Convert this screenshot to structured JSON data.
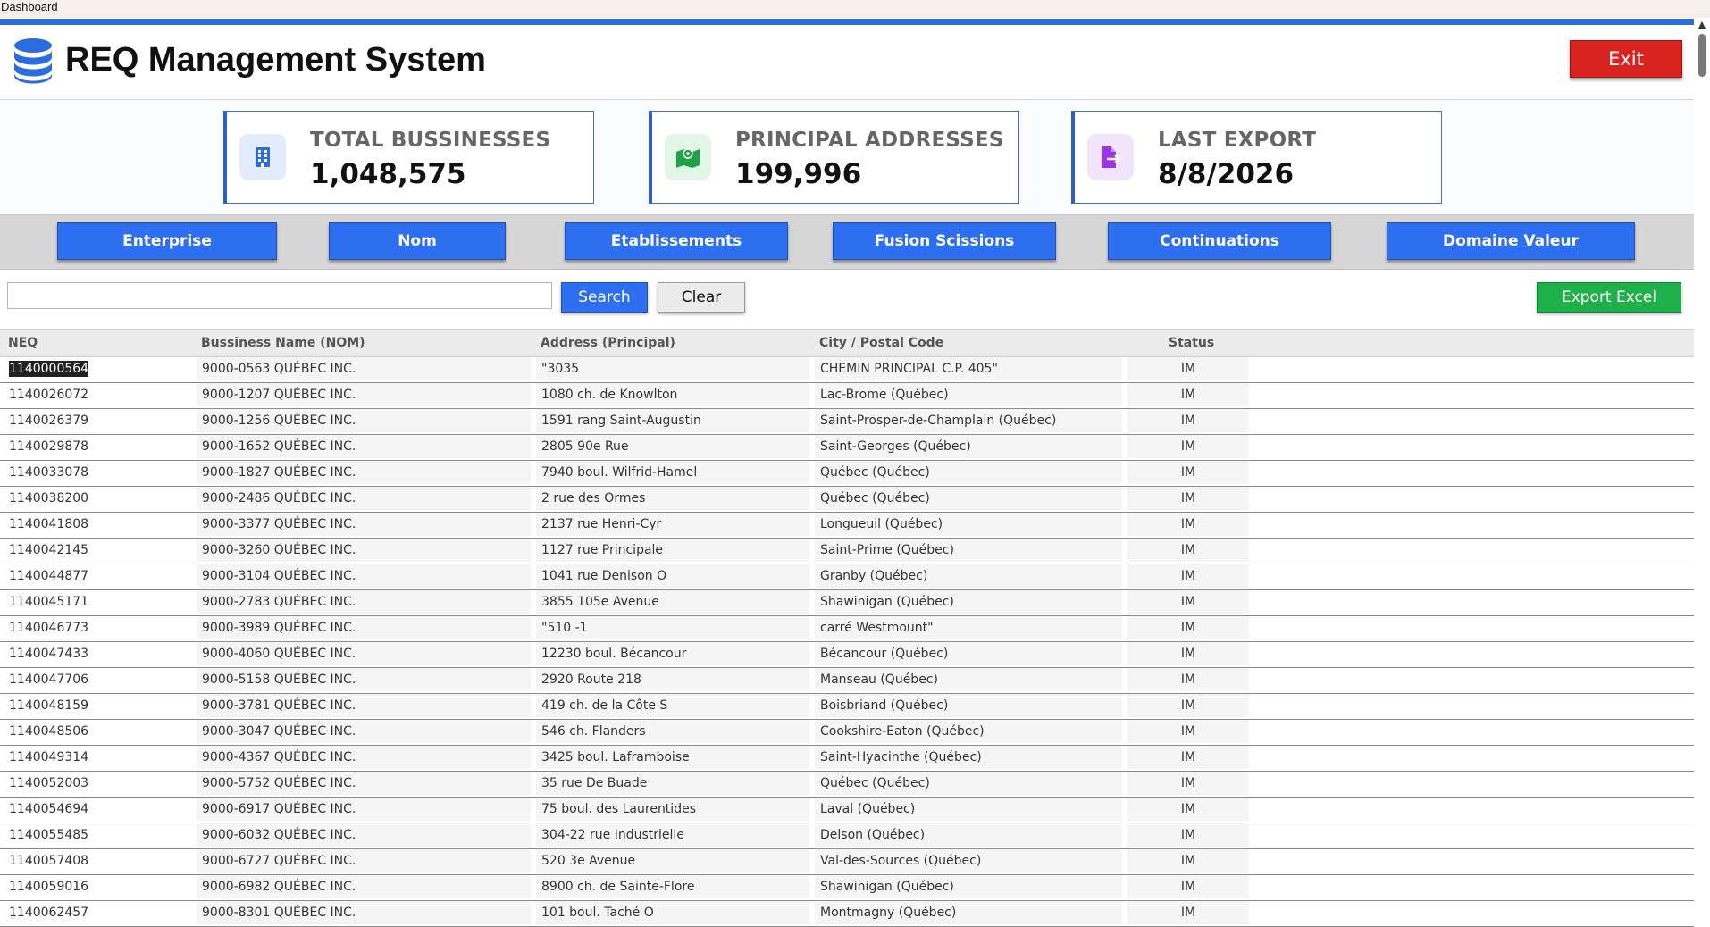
{
  "window": {
    "title": "Dashboard"
  },
  "header": {
    "app_title": "REQ Management System",
    "exit_label": "Exit"
  },
  "colors": {
    "accent": "#2e6ff0",
    "exit": "#d9231f",
    "export": "#1fb04a"
  },
  "cards": [
    {
      "label": "TOTAL BUSSINESSES",
      "value": "1,048,575",
      "icon": "building-icon"
    },
    {
      "label": "PRINCIPAL ADDRESSES",
      "value": "199,996",
      "icon": "map-icon"
    },
    {
      "label": "LAST EXPORT",
      "value": "8/8/2026",
      "icon": "file-export-icon"
    }
  ],
  "nav": [
    "Enterprise",
    "Nom",
    "Etablissements",
    "Fusion Scissions",
    "Continuations",
    "Domaine Valeur"
  ],
  "search": {
    "value": "",
    "search_label": "Search",
    "clear_label": "Clear",
    "export_label": "Export Excel"
  },
  "table": {
    "columns": [
      "NEQ",
      "Bussiness Name (NOM)",
      "Address (Principal)",
      "City / Postal Code",
      "Status"
    ],
    "rows": [
      [
        "1140000564",
        "9000-0563 QUÉBEC INC.",
        "\"3035",
        "CHEMIN PRINCIPAL C.P. 405\"",
        "IM"
      ],
      [
        "1140026072",
        "9000-1207 QUÉBEC INC.",
        "1080 ch. de Knowlton",
        "Lac-Brome (Québec)",
        "IM"
      ],
      [
        "1140026379",
        "9000-1256 QUÉBEC INC.",
        "1591 rang Saint-Augustin",
        "Saint-Prosper-de-Champlain (Québec)",
        "IM"
      ],
      [
        "1140029878",
        "9000-1652 QUÉBEC INC.",
        "2805 90e Rue",
        "Saint-Georges (Québec)",
        "IM"
      ],
      [
        "1140033078",
        "9000-1827 QUÉBEC INC.",
        "7940 boul. Wilfrid-Hamel",
        "Québec (Québec)",
        "IM"
      ],
      [
        "1140038200",
        "9000-2486 QUÉBEC INC.",
        "2 rue des Ormes",
        "Québec (Québec)",
        "IM"
      ],
      [
        "1140041808",
        "9000-3377 QUÉBEC INC.",
        "2137 rue Henri-Cyr",
        "Longueuil (Québec)",
        "IM"
      ],
      [
        "1140042145",
        "9000-3260 QUÉBEC INC.",
        "1127 rue Principale",
        "Saint-Prime (Québec)",
        "IM"
      ],
      [
        "1140044877",
        "9000-3104 QUÉBEC INC.",
        "1041 rue Denison O",
        "Granby (Québec)",
        "IM"
      ],
      [
        "1140045171",
        "9000-2783 QUÉBEC INC.",
        "3855 105e Avenue",
        "Shawinigan (Québec)",
        "IM"
      ],
      [
        "1140046773",
        "9000-3989 QUÉBEC INC.",
        "\"510 -1",
        "carré Westmount\"",
        "IM"
      ],
      [
        "1140047433",
        "9000-4060 QUÉBEC INC.",
        "12230 boul. Bécancour",
        "Bécancour (Québec)",
        "IM"
      ],
      [
        "1140047706",
        "9000-5158 QUÉBEC INC.",
        "2920 Route 218",
        "Manseau (Québec)",
        "IM"
      ],
      [
        "1140048159",
        "9000-3781 QUÉBEC INC.",
        "419 ch. de la Côte S",
        "Boisbriand (Québec)",
        "IM"
      ],
      [
        "1140048506",
        "9000-3047 QUÉBEC INC.",
        "546 ch. Flanders",
        "Cookshire-Eaton (Québec)",
        "IM"
      ],
      [
        "1140049314",
        "9000-4367 QUÉBEC INC.",
        "3425 boul. Laframboise",
        "Saint-Hyacinthe (Québec)",
        "IM"
      ],
      [
        "1140052003",
        "9000-5752 QUÉBEC INC.",
        "35 rue De Buade",
        "Québec (Québec)",
        "IM"
      ],
      [
        "1140054694",
        "9000-6917 QUÉBEC INC.",
        "75 boul. des Laurentides",
        "Laval (Québec)",
        "IM"
      ],
      [
        "1140055485",
        "9000-6032 QUÉBEC INC.",
        "304-22 rue Industrielle",
        "Delson (Québec)",
        "IM"
      ],
      [
        "1140057408",
        "9000-6727 QUÉBEC INC.",
        "520 3e Avenue",
        "Val-des-Sources (Québec)",
        "IM"
      ],
      [
        "1140059016",
        "9000-6982 QUÉBEC INC.",
        "8900 ch. de Sainte-Flore",
        "Shawinigan (Québec)",
        "IM"
      ],
      [
        "1140062457",
        "9000-8301 QUÉBEC INC.",
        "101 boul. Taché O",
        "Montmagny (Québec)",
        "IM"
      ]
    ]
  }
}
